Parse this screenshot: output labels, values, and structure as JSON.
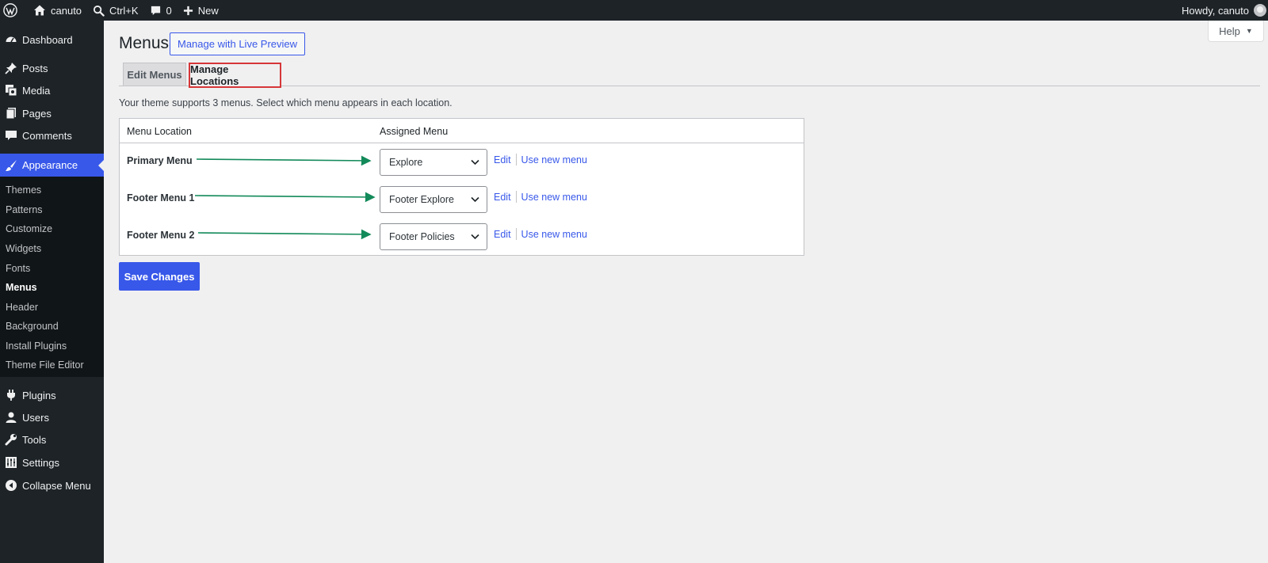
{
  "admin_bar": {
    "site_name": "canuto",
    "search_shortcut": "Ctrl+K",
    "comments_count": "0",
    "new_label": "New",
    "howdy": "Howdy, canuto"
  },
  "sidebar": {
    "top_items": [
      {
        "label": "Dashboard",
        "icon": "dashboard-icon"
      },
      {
        "label": "Posts",
        "icon": "pin-icon"
      },
      {
        "label": "Media",
        "icon": "media-icon"
      },
      {
        "label": "Pages",
        "icon": "pages-icon"
      },
      {
        "label": "Comments",
        "icon": "comment-icon"
      },
      {
        "label": "Appearance",
        "icon": "paintbrush-icon"
      }
    ],
    "appearance_submenu": [
      "Themes",
      "Patterns",
      "Customize",
      "Widgets",
      "Fonts",
      "Menus",
      "Header",
      "Background",
      "Install Plugins",
      "Theme File Editor"
    ],
    "bottom_items": [
      {
        "label": "Plugins",
        "icon": "plugin-icon"
      },
      {
        "label": "Users",
        "icon": "user-icon"
      },
      {
        "label": "Tools",
        "icon": "wrench-icon"
      },
      {
        "label": "Settings",
        "icon": "settings-icon"
      },
      {
        "label": "Collapse Menu",
        "icon": "collapse-icon"
      }
    ]
  },
  "page": {
    "title": "Menus",
    "live_preview_label": "Manage with Live Preview",
    "help_label": "Help",
    "tabs": [
      "Edit Menus",
      "Manage Locations"
    ],
    "active_tab": "Manage Locations",
    "intro": "Your theme supports 3 menus. Select which menu appears in each location.",
    "table_headers": [
      "Menu Location",
      "Assigned Menu"
    ],
    "locations": [
      {
        "location": "Primary Menu",
        "assigned": "Explore",
        "edit": "Edit",
        "use_new": "Use new menu"
      },
      {
        "location": "Footer Menu 1",
        "assigned": "Footer Explore",
        "edit": "Edit",
        "use_new": "Use new menu"
      },
      {
        "location": "Footer Menu 2",
        "assigned": "Footer Policies",
        "edit": "Edit",
        "use_new": "Use new menu"
      }
    ],
    "save_label": "Save Changes"
  },
  "colors": {
    "accent": "#3858e9",
    "admin_bar_bg": "#1d2327",
    "highlight_border": "#d63638",
    "annotation_arrow": "#138a5a"
  }
}
